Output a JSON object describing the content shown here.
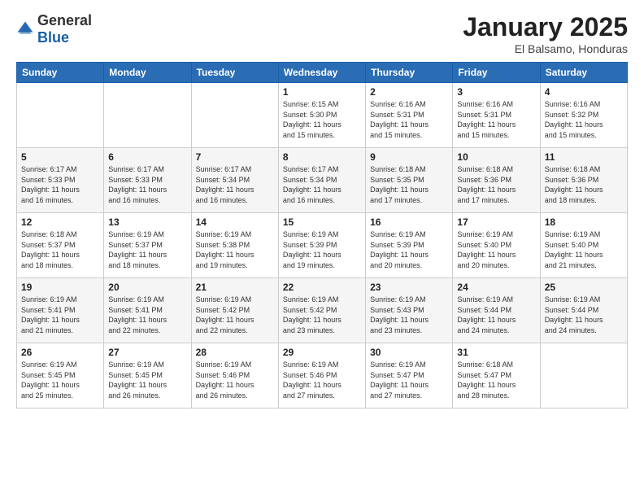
{
  "logo": {
    "general": "General",
    "blue": "Blue"
  },
  "title": {
    "month": "January 2025",
    "location": "El Balsamo, Honduras"
  },
  "days_header": [
    "Sunday",
    "Monday",
    "Tuesday",
    "Wednesday",
    "Thursday",
    "Friday",
    "Saturday"
  ],
  "weeks": [
    [
      {
        "day": "",
        "info": ""
      },
      {
        "day": "",
        "info": ""
      },
      {
        "day": "",
        "info": ""
      },
      {
        "day": "1",
        "info": "Sunrise: 6:15 AM\nSunset: 5:30 PM\nDaylight: 11 hours\nand 15 minutes."
      },
      {
        "day": "2",
        "info": "Sunrise: 6:16 AM\nSunset: 5:31 PM\nDaylight: 11 hours\nand 15 minutes."
      },
      {
        "day": "3",
        "info": "Sunrise: 6:16 AM\nSunset: 5:31 PM\nDaylight: 11 hours\nand 15 minutes."
      },
      {
        "day": "4",
        "info": "Sunrise: 6:16 AM\nSunset: 5:32 PM\nDaylight: 11 hours\nand 15 minutes."
      }
    ],
    [
      {
        "day": "5",
        "info": "Sunrise: 6:17 AM\nSunset: 5:33 PM\nDaylight: 11 hours\nand 16 minutes."
      },
      {
        "day": "6",
        "info": "Sunrise: 6:17 AM\nSunset: 5:33 PM\nDaylight: 11 hours\nand 16 minutes."
      },
      {
        "day": "7",
        "info": "Sunrise: 6:17 AM\nSunset: 5:34 PM\nDaylight: 11 hours\nand 16 minutes."
      },
      {
        "day": "8",
        "info": "Sunrise: 6:17 AM\nSunset: 5:34 PM\nDaylight: 11 hours\nand 16 minutes."
      },
      {
        "day": "9",
        "info": "Sunrise: 6:18 AM\nSunset: 5:35 PM\nDaylight: 11 hours\nand 17 minutes."
      },
      {
        "day": "10",
        "info": "Sunrise: 6:18 AM\nSunset: 5:36 PM\nDaylight: 11 hours\nand 17 minutes."
      },
      {
        "day": "11",
        "info": "Sunrise: 6:18 AM\nSunset: 5:36 PM\nDaylight: 11 hours\nand 18 minutes."
      }
    ],
    [
      {
        "day": "12",
        "info": "Sunrise: 6:18 AM\nSunset: 5:37 PM\nDaylight: 11 hours\nand 18 minutes."
      },
      {
        "day": "13",
        "info": "Sunrise: 6:19 AM\nSunset: 5:37 PM\nDaylight: 11 hours\nand 18 minutes."
      },
      {
        "day": "14",
        "info": "Sunrise: 6:19 AM\nSunset: 5:38 PM\nDaylight: 11 hours\nand 19 minutes."
      },
      {
        "day": "15",
        "info": "Sunrise: 6:19 AM\nSunset: 5:39 PM\nDaylight: 11 hours\nand 19 minutes."
      },
      {
        "day": "16",
        "info": "Sunrise: 6:19 AM\nSunset: 5:39 PM\nDaylight: 11 hours\nand 20 minutes."
      },
      {
        "day": "17",
        "info": "Sunrise: 6:19 AM\nSunset: 5:40 PM\nDaylight: 11 hours\nand 20 minutes."
      },
      {
        "day": "18",
        "info": "Sunrise: 6:19 AM\nSunset: 5:40 PM\nDaylight: 11 hours\nand 21 minutes."
      }
    ],
    [
      {
        "day": "19",
        "info": "Sunrise: 6:19 AM\nSunset: 5:41 PM\nDaylight: 11 hours\nand 21 minutes."
      },
      {
        "day": "20",
        "info": "Sunrise: 6:19 AM\nSunset: 5:41 PM\nDaylight: 11 hours\nand 22 minutes."
      },
      {
        "day": "21",
        "info": "Sunrise: 6:19 AM\nSunset: 5:42 PM\nDaylight: 11 hours\nand 22 minutes."
      },
      {
        "day": "22",
        "info": "Sunrise: 6:19 AM\nSunset: 5:42 PM\nDaylight: 11 hours\nand 23 minutes."
      },
      {
        "day": "23",
        "info": "Sunrise: 6:19 AM\nSunset: 5:43 PM\nDaylight: 11 hours\nand 23 minutes."
      },
      {
        "day": "24",
        "info": "Sunrise: 6:19 AM\nSunset: 5:44 PM\nDaylight: 11 hours\nand 24 minutes."
      },
      {
        "day": "25",
        "info": "Sunrise: 6:19 AM\nSunset: 5:44 PM\nDaylight: 11 hours\nand 24 minutes."
      }
    ],
    [
      {
        "day": "26",
        "info": "Sunrise: 6:19 AM\nSunset: 5:45 PM\nDaylight: 11 hours\nand 25 minutes."
      },
      {
        "day": "27",
        "info": "Sunrise: 6:19 AM\nSunset: 5:45 PM\nDaylight: 11 hours\nand 26 minutes."
      },
      {
        "day": "28",
        "info": "Sunrise: 6:19 AM\nSunset: 5:46 PM\nDaylight: 11 hours\nand 26 minutes."
      },
      {
        "day": "29",
        "info": "Sunrise: 6:19 AM\nSunset: 5:46 PM\nDaylight: 11 hours\nand 27 minutes."
      },
      {
        "day": "30",
        "info": "Sunrise: 6:19 AM\nSunset: 5:47 PM\nDaylight: 11 hours\nand 27 minutes."
      },
      {
        "day": "31",
        "info": "Sunrise: 6:18 AM\nSunset: 5:47 PM\nDaylight: 11 hours\nand 28 minutes."
      },
      {
        "day": "",
        "info": ""
      }
    ]
  ]
}
